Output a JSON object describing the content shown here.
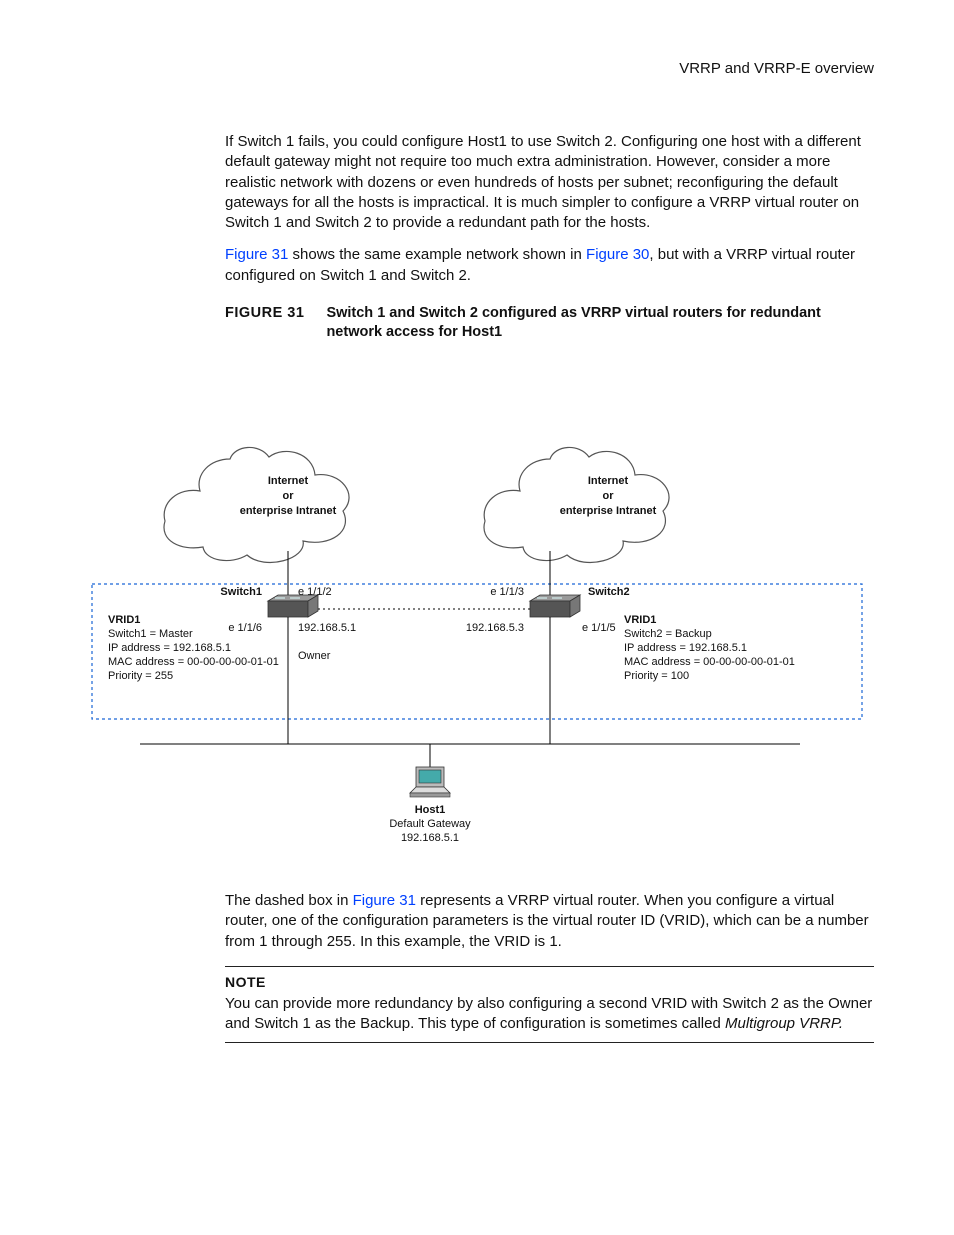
{
  "header": {
    "title": "VRRP and VRRP-E overview"
  },
  "intro": {
    "p1": "If Switch 1 fails, you could configure Host1 to use Switch 2.  Configuring one host with a different default gateway might not require too much extra administration.  However, consider a more realistic network with dozens or even hundreds of hosts per subnet; reconfiguring the default gateways for all the hosts is impractical.  It is much simpler to configure a VRRP virtual router on Switch 1 and Switch 2 to provide a redundant path for the hosts.",
    "p2a": "Figure 31",
    "p2b": " shows the same example network shown in ",
    "p2c": "Figure 30",
    "p2d": ", but with a VRRP virtual router configured on Switch 1 and Switch 2."
  },
  "figure": {
    "label": "FIGURE 31",
    "caption": "Switch 1 and Switch 2 configured as VRRP virtual routers for redundant network access for Host1"
  },
  "diagram": {
    "cloud_left": {
      "l1": "Internet",
      "l2": "or",
      "l3": "enterprise Intranet"
    },
    "cloud_right": {
      "l1": "Internet",
      "l2": "or",
      "l3": "enterprise Intranet"
    },
    "switch1": {
      "name": "Switch1",
      "port_top": "e 1/1/2",
      "port_side": "e 1/1/6",
      "ip": "192.168.5.1",
      "owner": "Owner"
    },
    "switch2": {
      "name": "Switch2",
      "port_top": "e 1/1/3",
      "port_side": "e 1/1/5",
      "ip": "192.168.5.3"
    },
    "vrid_left": {
      "title": "VRID1",
      "l1": "Switch1 = Master",
      "l2": "IP address = 192.168.5.1",
      "l3": "MAC address = 00-00-00-00-01-01",
      "l4": "Priority = 255"
    },
    "vrid_right": {
      "title": "VRID1",
      "l1": "Switch2 = Backup",
      "l2": "IP address = 192.168.5.1",
      "l3": "MAC address = 00-00-00-00-01-01",
      "l4": "Priority = 100"
    },
    "host": {
      "name": "Host1",
      "l1": "Default Gateway",
      "l2": "192.168.5.1"
    }
  },
  "after": {
    "p1a": "The dashed box in ",
    "p1b": "Figure 31",
    "p1c": " represents a VRRP virtual router.  When you configure a virtual router, one of the configuration parameters is the virtual router ID (VRID), which can be a number from 1 through 255.  In this example, the VRID is 1."
  },
  "note": {
    "title": "NOTE",
    "body_a": "You can provide more redundancy by also configuring a second VRID with Switch 2 as the Owner and Switch 1 as the Backup.  This type of configuration is sometimes called ",
    "body_em": "Multigroup VRRP."
  }
}
